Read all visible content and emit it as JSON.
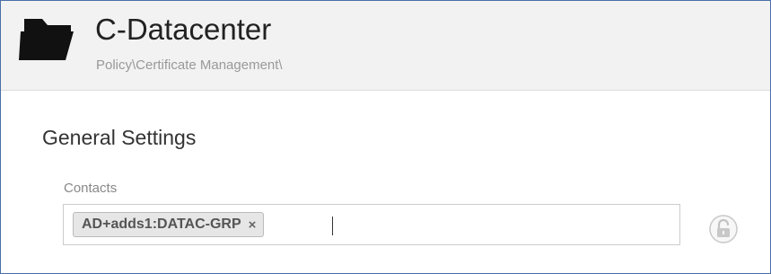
{
  "header": {
    "title": "C-Datacenter",
    "breadcrumb": "Policy\\Certificate Management\\",
    "icon": "folder-open-icon"
  },
  "section": {
    "title": "General Settings"
  },
  "contacts": {
    "label": "Contacts",
    "tags": [
      {
        "label": "AD+adds1:DATAC-GRP",
        "remove_glyph": "×"
      }
    ],
    "input_value": ""
  },
  "lock": {
    "icon": "unlocked-padlock-icon",
    "state": "unlocked"
  },
  "colors": {
    "header_background": "#f2f2f2",
    "frame_border": "#4a6fa8",
    "tag_background": "#e6e6e6"
  }
}
